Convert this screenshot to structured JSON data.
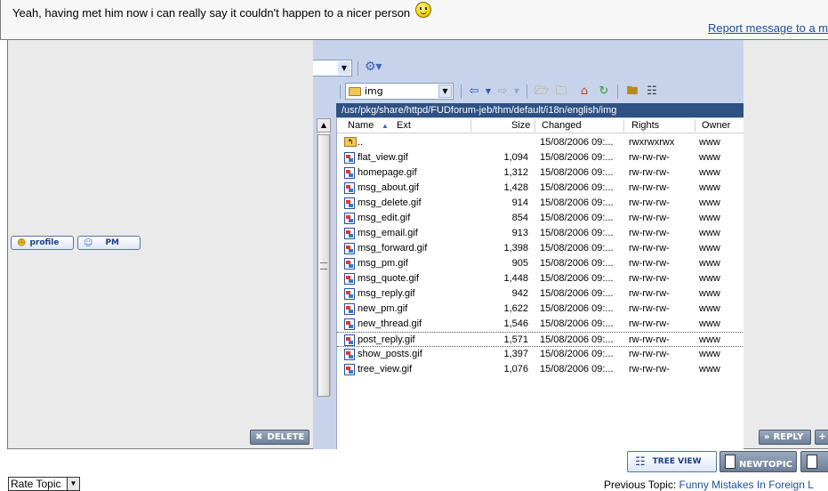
{
  "message": {
    "text": "Yeah, having met him now i can really say it couldn't happen to a nicer person",
    "report_link": "Report message to a m"
  },
  "post_buttons": {
    "profile": "profile",
    "pm": "PM",
    "delete": "DELETE",
    "reply": "REPLY"
  },
  "file_manager": {
    "path_combo": "img",
    "address": "/usr/pkg/share/httpd/FUDforum-jeb/thm/default/i18n/english/img",
    "columns": {
      "name": "Name",
      "ext": "Ext",
      "size": "Size",
      "changed": "Changed",
      "rights": "Rights",
      "owner": "Owner"
    },
    "rows": [
      {
        "name": "..",
        "size": "",
        "changed": "15/08/2006 09:...",
        "rights": "rwxrwxrwx",
        "owner": "www"
      },
      {
        "name": "flat_view.gif",
        "size": "1,094",
        "changed": "15/08/2006 09:...",
        "rights": "rw-rw-rw-",
        "owner": "www"
      },
      {
        "name": "homepage.gif",
        "size": "1,312",
        "changed": "15/08/2006 09:...",
        "rights": "rw-rw-rw-",
        "owner": "www"
      },
      {
        "name": "msg_about.gif",
        "size": "1,428",
        "changed": "15/08/2006 09:...",
        "rights": "rw-rw-rw-",
        "owner": "www"
      },
      {
        "name": "msg_delete.gif",
        "size": "914",
        "changed": "15/08/2006 09:...",
        "rights": "rw-rw-rw-",
        "owner": "www"
      },
      {
        "name": "msg_edit.gif",
        "size": "854",
        "changed": "15/08/2006 09:...",
        "rights": "rw-rw-rw-",
        "owner": "www"
      },
      {
        "name": "msg_email.gif",
        "size": "913",
        "changed": "15/08/2006 09:...",
        "rights": "rw-rw-rw-",
        "owner": "www"
      },
      {
        "name": "msg_forward.gif",
        "size": "1,398",
        "changed": "15/08/2006 09:...",
        "rights": "rw-rw-rw-",
        "owner": "www"
      },
      {
        "name": "msg_pm.gif",
        "size": "905",
        "changed": "15/08/2006 09:...",
        "rights": "rw-rw-rw-",
        "owner": "www"
      },
      {
        "name": "msg_quote.gif",
        "size": "1,448",
        "changed": "15/08/2006 09:...",
        "rights": "rw-rw-rw-",
        "owner": "www"
      },
      {
        "name": "msg_reply.gif",
        "size": "942",
        "changed": "15/08/2006 09:...",
        "rights": "rw-rw-rw-",
        "owner": "www"
      },
      {
        "name": "new_pm.gif",
        "size": "1,622",
        "changed": "15/08/2006 09:...",
        "rights": "rw-rw-rw-",
        "owner": "www"
      },
      {
        "name": "new_thread.gif",
        "size": "1,546",
        "changed": "15/08/2006 09:...",
        "rights": "rw-rw-rw-",
        "owner": "www"
      },
      {
        "name": "post_reply.gif",
        "size": "1,571",
        "changed": "15/08/2006 09:...",
        "rights": "rw-rw-rw-",
        "owner": "www"
      },
      {
        "name": "show_posts.gif",
        "size": "1,397",
        "changed": "15/08/2006 09:...",
        "rights": "rw-rw-rw-",
        "owner": "www"
      },
      {
        "name": "tree_view.gif",
        "size": "1,076",
        "changed": "15/08/2006 09:...",
        "rights": "rw-rw-rw-",
        "owner": "www"
      }
    ],
    "selected_row": 13
  },
  "bottom": {
    "tree_view": "TREE VIEW",
    "new_topic": "NEWTOPIC",
    "rate_topic": "Rate Topic",
    "prev_label": "Previous Topic:",
    "prev_link": "Funny Mistakes In Foreign L"
  }
}
